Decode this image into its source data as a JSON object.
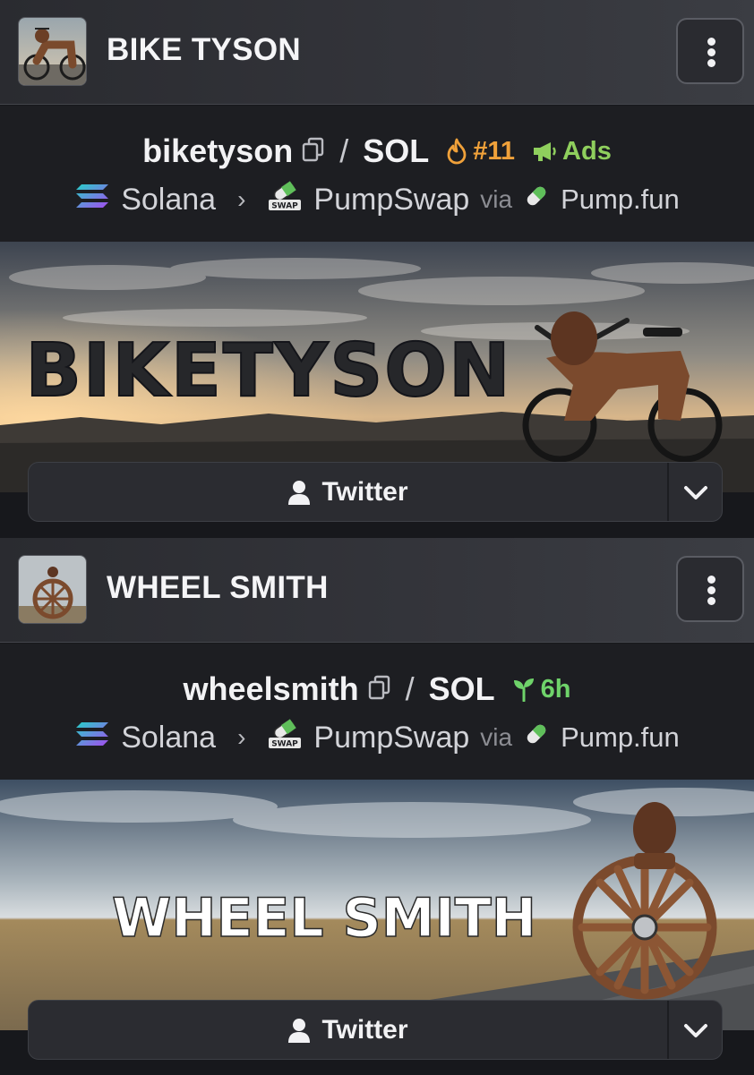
{
  "colors": {
    "card_background": "#1d1e22",
    "rank_color": "#f0a13a",
    "ads_color": "#8fcf5d",
    "age_color": "#6fd36a"
  },
  "tokens": [
    {
      "name": "BIKE TYSON",
      "symbol": "biketyson",
      "quote": "SOL",
      "badge_rank": "#11",
      "badge_ads": "Ads",
      "chain": "Solana",
      "dex": "PumpSwap",
      "dex_icon_text": "SWAP",
      "via": "via",
      "launchpad": "Pump.fun",
      "banner_text": "BIKETYSON",
      "link_label": "Twitter"
    },
    {
      "name": "WHEEL SMITH",
      "symbol": "wheelsmith",
      "quote": "SOL",
      "badge_age": "6h",
      "chain": "Solana",
      "dex": "PumpSwap",
      "dex_icon_text": "SWAP",
      "via": "via",
      "launchpad": "Pump.fun",
      "banner_text": "WHEEL SMITH",
      "link_label": "Twitter"
    }
  ]
}
